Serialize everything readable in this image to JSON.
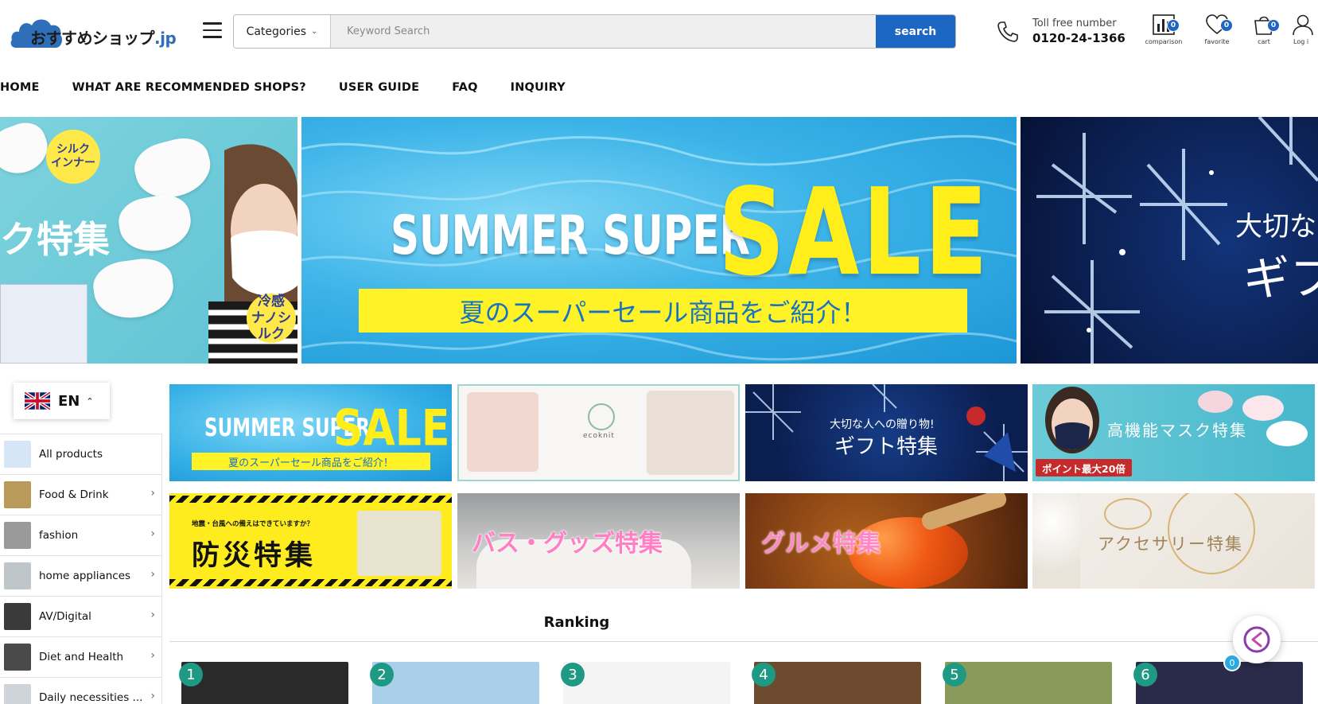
{
  "header": {
    "logo_text": "おすすめショップ",
    "logo_suffix": ".jp",
    "categories_label": "Categories",
    "search_placeholder": "Keyword Search",
    "search_button": "search",
    "toll_label": "Toll free number",
    "toll_number": "0120-24-1366",
    "icons": [
      {
        "name": "comparison-icon",
        "label": "comparison",
        "badge": "0"
      },
      {
        "name": "favorite-icon",
        "label": "favorite",
        "badge": "0"
      },
      {
        "name": "cart-icon",
        "label": "cart",
        "badge": "0"
      },
      {
        "name": "user-icon",
        "label": "Log i"
      }
    ]
  },
  "nav": {
    "items": [
      "HOME",
      "WHAT ARE RECOMMENDED SHOPS?",
      "USER GUIDE",
      "FAQ",
      "INQUIRY"
    ]
  },
  "hero": {
    "left": {
      "tag1": "シルク\nインナー",
      "title": "ク特集",
      "tag2": "冷感\nナノシルク"
    },
    "middle": {
      "line1": "SUMMER SUPER",
      "big": "SALE",
      "strip": "夏のスーパーセール商品をご紹介！"
    },
    "right": {
      "line1": "大切な",
      "line2": "ギフ"
    }
  },
  "language": {
    "code": "EN"
  },
  "sidebar": {
    "items": [
      {
        "label": "All products",
        "thumb": "#d7e6f6",
        "arrow": false
      },
      {
        "label": "Food & Drink",
        "thumb": "#b99a5a",
        "arrow": true
      },
      {
        "label": "fashion",
        "thumb": "#9a9a9a",
        "arrow": true
      },
      {
        "label": "home appliances",
        "thumb": "#bfc6c9",
        "arrow": true
      },
      {
        "label": "AV/Digital",
        "thumb": "#3a3a3a",
        "arrow": true
      },
      {
        "label": "Diet and Health",
        "thumb": "#4a4a4a",
        "arrow": true
      },
      {
        "label": "Daily necessities ...",
        "thumb": "#cfd3da",
        "arrow": true
      }
    ]
  },
  "banners": {
    "sale": {
      "line1": "SUMMER SUPER",
      "big": "SALE",
      "strip": "夏のスーパーセール商品をご紹介！"
    },
    "ecoknit": {
      "brand": "ecoknit"
    },
    "gift": {
      "line1": "大切な人への贈り物!",
      "line2": "ギフト特集"
    },
    "mask": {
      "title": "高機能マスク特集",
      "badge": "ポイント最大20倍"
    },
    "bosai": {
      "line1": "地震・台風への備えはできていますか？",
      "line2": "防災特集"
    },
    "bath": {
      "title": "バス・グッズ特集"
    },
    "gourmet": {
      "title": "グルメ特集"
    },
    "accessory": {
      "title": "アクセサリー特集"
    }
  },
  "ranking": {
    "title": "Ranking",
    "items": [
      {
        "rank": "1",
        "color": "#2a2a2a"
      },
      {
        "rank": "2",
        "color": "#a9cfe9"
      },
      {
        "rank": "3",
        "color": "#f4f4f4"
      },
      {
        "rank": "4",
        "color": "#6b4a2e"
      },
      {
        "rank": "5",
        "color": "#8a9a5a"
      },
      {
        "rank": "6",
        "color": "#2a2a4a"
      }
    ]
  },
  "chat": {
    "badge": "0"
  },
  "colors": {
    "accent": "#1d67c4",
    "rank_badge": "#1e9a84",
    "sale_yellow": "#ffee1a"
  }
}
